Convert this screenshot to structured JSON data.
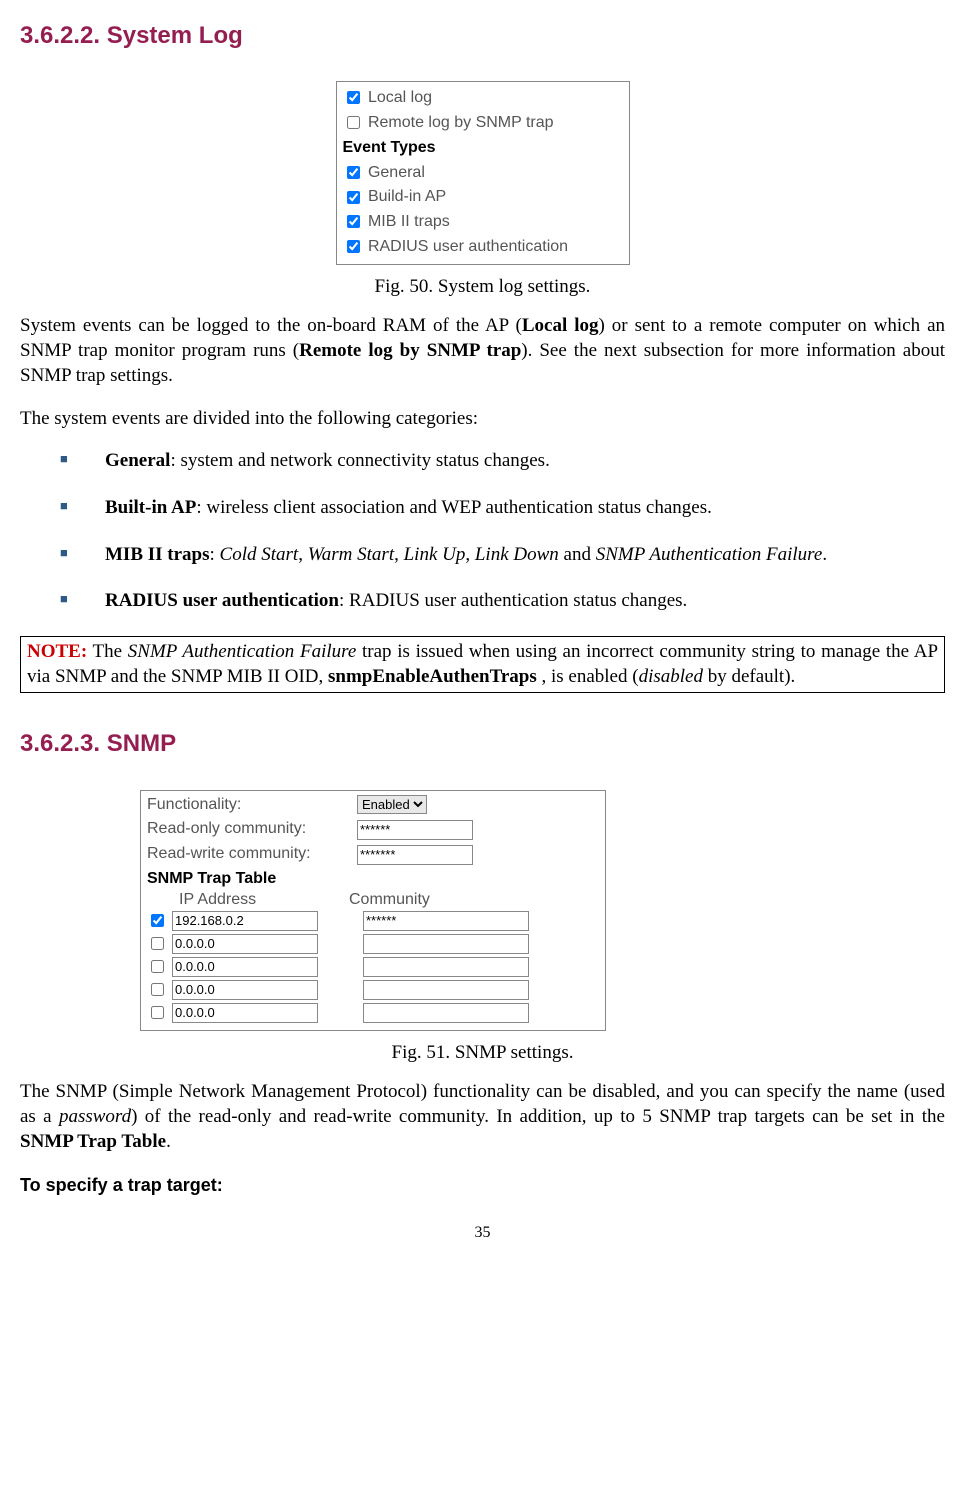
{
  "headings": {
    "h1": "3.6.2.2. System Log",
    "h2": "3.6.2.3. SNMP"
  },
  "fig50": {
    "cb1_label": "Local log",
    "cb2_label": "Remote log by SNMP trap",
    "section": "Event Types",
    "cb3_label": "General",
    "cb4_label": "Build-in AP",
    "cb5_label": "MIB II traps",
    "cb6_label": "RADIUS user authentication",
    "caption": "Fig. 50. System log settings."
  },
  "para1_a": "System events  can be logged  to the on-board RAM of the AP (",
  "para1_b": "Local log",
  "para1_c": ") or sent to a remote computer on which an SNMP trap monitor program runs (",
  "para1_d": "Remote log by SNMP trap",
  "para1_e": "). See the next subsection for more information about SNMP trap settings.",
  "para2": "The system events are divided into the following categories:",
  "bullets": {
    "b1_a": "General",
    "b1_b": ": system and network connectivity status changes.",
    "b2_a": "Built-in AP",
    "b2_b": ": wireless client association and WEP authentication status changes.",
    "b3_a": "MIB II traps",
    "b3_b": ": ",
    "b3_c": "Cold Start",
    "b3_d": ", ",
    "b3_e": "Warm Start",
    "b3_f": ", ",
    "b3_g": "Link Up",
    "b3_h": ", ",
    "b3_i": "Link Down",
    "b3_j": " and ",
    "b3_k": "SNMP Authentication Failure",
    "b3_l": ".",
    "b4_a": "RADIUS user authentication",
    "b4_b": ": RADIUS user authentication status changes."
  },
  "note": {
    "label": "NOTE:",
    "a": " The ",
    "b": "SNMP Authentication Failure",
    "c": " trap is issued when using an incorrect community string to manage the AP via SNMP and the SNMP MIB II OID, ",
    "d": "snmpEnableAuthenTraps",
    "e": " , is enabled (",
    "f": "disabled",
    "g": " by default)."
  },
  "fig51": {
    "func_label": "Functionality:",
    "func_value": "Enabled",
    "ro_label": "Read-only community:",
    "ro_value": "******",
    "rw_label": "Read-write community:",
    "rw_value": "*******",
    "trap_title": "SNMP Trap Table",
    "col1": "IP Address",
    "col2": "Community",
    "rows": [
      {
        "checked": true,
        "ip": "192.168.0.2",
        "comm": "******"
      },
      {
        "checked": false,
        "ip": "0.0.0.0",
        "comm": ""
      },
      {
        "checked": false,
        "ip": "0.0.0.0",
        "comm": ""
      },
      {
        "checked": false,
        "ip": "0.0.0.0",
        "comm": ""
      },
      {
        "checked": false,
        "ip": "0.0.0.0",
        "comm": ""
      }
    ],
    "caption": "Fig. 51. SNMP settings."
  },
  "para3_a": "The SNMP (Simple Network Management Protocol) functionality can be disabled, and you can specify the name (used as a ",
  "para3_b": "password",
  "para3_c": ") of the read-only and read-write community. In addition, up to 5 SNMP trap targets can be set in the ",
  "para3_d": "SNMP Trap Table",
  "para3_e": ".",
  "subhead": "To specify a trap target:",
  "page_num": "35"
}
